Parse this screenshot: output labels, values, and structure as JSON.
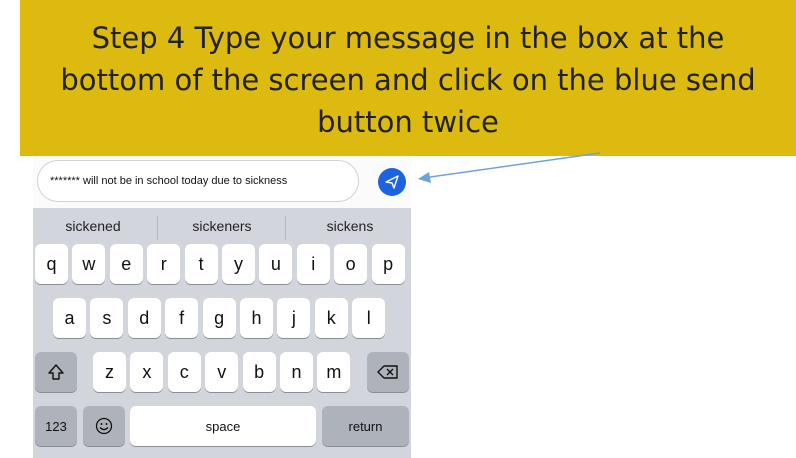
{
  "banner": {
    "lines": [
      "Step 4 Type your message in the box at the",
      "bottom of the screen and click on the blue send",
      "button twice"
    ]
  },
  "message": {
    "value": "******* will not be in school today due to sickness"
  },
  "suggestions": [
    "sickened",
    "sickeners",
    "sickens"
  ],
  "keyboard": {
    "row1": [
      "q",
      "w",
      "e",
      "r",
      "t",
      "y",
      "u",
      "i",
      "o",
      "p"
    ],
    "row2": [
      "a",
      "s",
      "d",
      "f",
      "g",
      "h",
      "j",
      "k",
      "l"
    ],
    "row3": [
      "z",
      "x",
      "c",
      "v",
      "b",
      "n",
      "m"
    ],
    "numbers_label": "123",
    "space_label": "space",
    "return_label": "return"
  },
  "colors": {
    "banner": "#dcba0f",
    "send": "#1d63e0",
    "arrow": "#6fa3d8"
  },
  "icons": {
    "send": "send-icon",
    "shift": "shift-icon",
    "backspace": "backspace-icon",
    "emoji": "emoji-icon"
  }
}
